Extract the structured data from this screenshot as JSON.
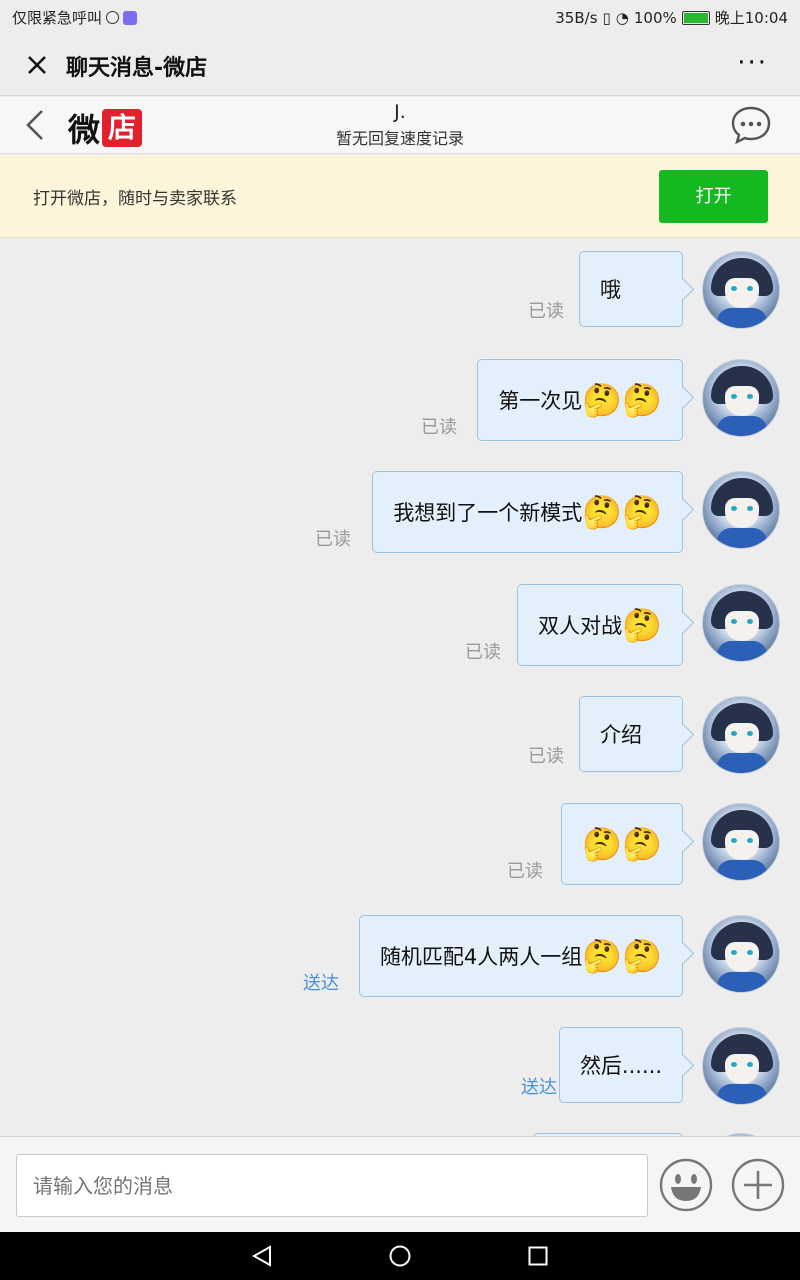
{
  "status_bar": {
    "carrier": "仅限紧急呼叫",
    "speed": "35B/s",
    "battery": "100%",
    "time": "晚上10:04"
  },
  "titlebar": {
    "title": "聊天消息-微店",
    "more": "···"
  },
  "shop_header": {
    "logo_left": "微",
    "logo_right": "店",
    "contact_name": "J.",
    "subtitle": "暂无回复速度记录"
  },
  "banner": {
    "text": "打开微店，随时与卖家联系",
    "button": "打开"
  },
  "messages": [
    {
      "text": "哦",
      "emojis": "",
      "status": "已读"
    },
    {
      "text": "第一次见",
      "emojis": "🤔🤔",
      "status": "已读"
    },
    {
      "text": "我想到了一个新模式",
      "emojis": "🤔🤔",
      "status": "已读"
    },
    {
      "text": "双人对战",
      "emojis": "🤔",
      "status": "已读"
    },
    {
      "text": "介绍",
      "emojis": "",
      "status": "已读"
    },
    {
      "text": "",
      "emojis": "🤔🤔",
      "status": "已读"
    },
    {
      "text": "随机匹配4人两人一组",
      "emojis": "🤔🤔",
      "status": "送达"
    },
    {
      "text": "然后......",
      "emojis": "",
      "status": "送达"
    }
  ],
  "input": {
    "placeholder": "请输入您的消息"
  },
  "colors": {
    "accent_green": "#14b820",
    "logo_red": "#e0222f",
    "bubble_bg": "#e3f0fb",
    "sent_status": "#4a90d9"
  }
}
